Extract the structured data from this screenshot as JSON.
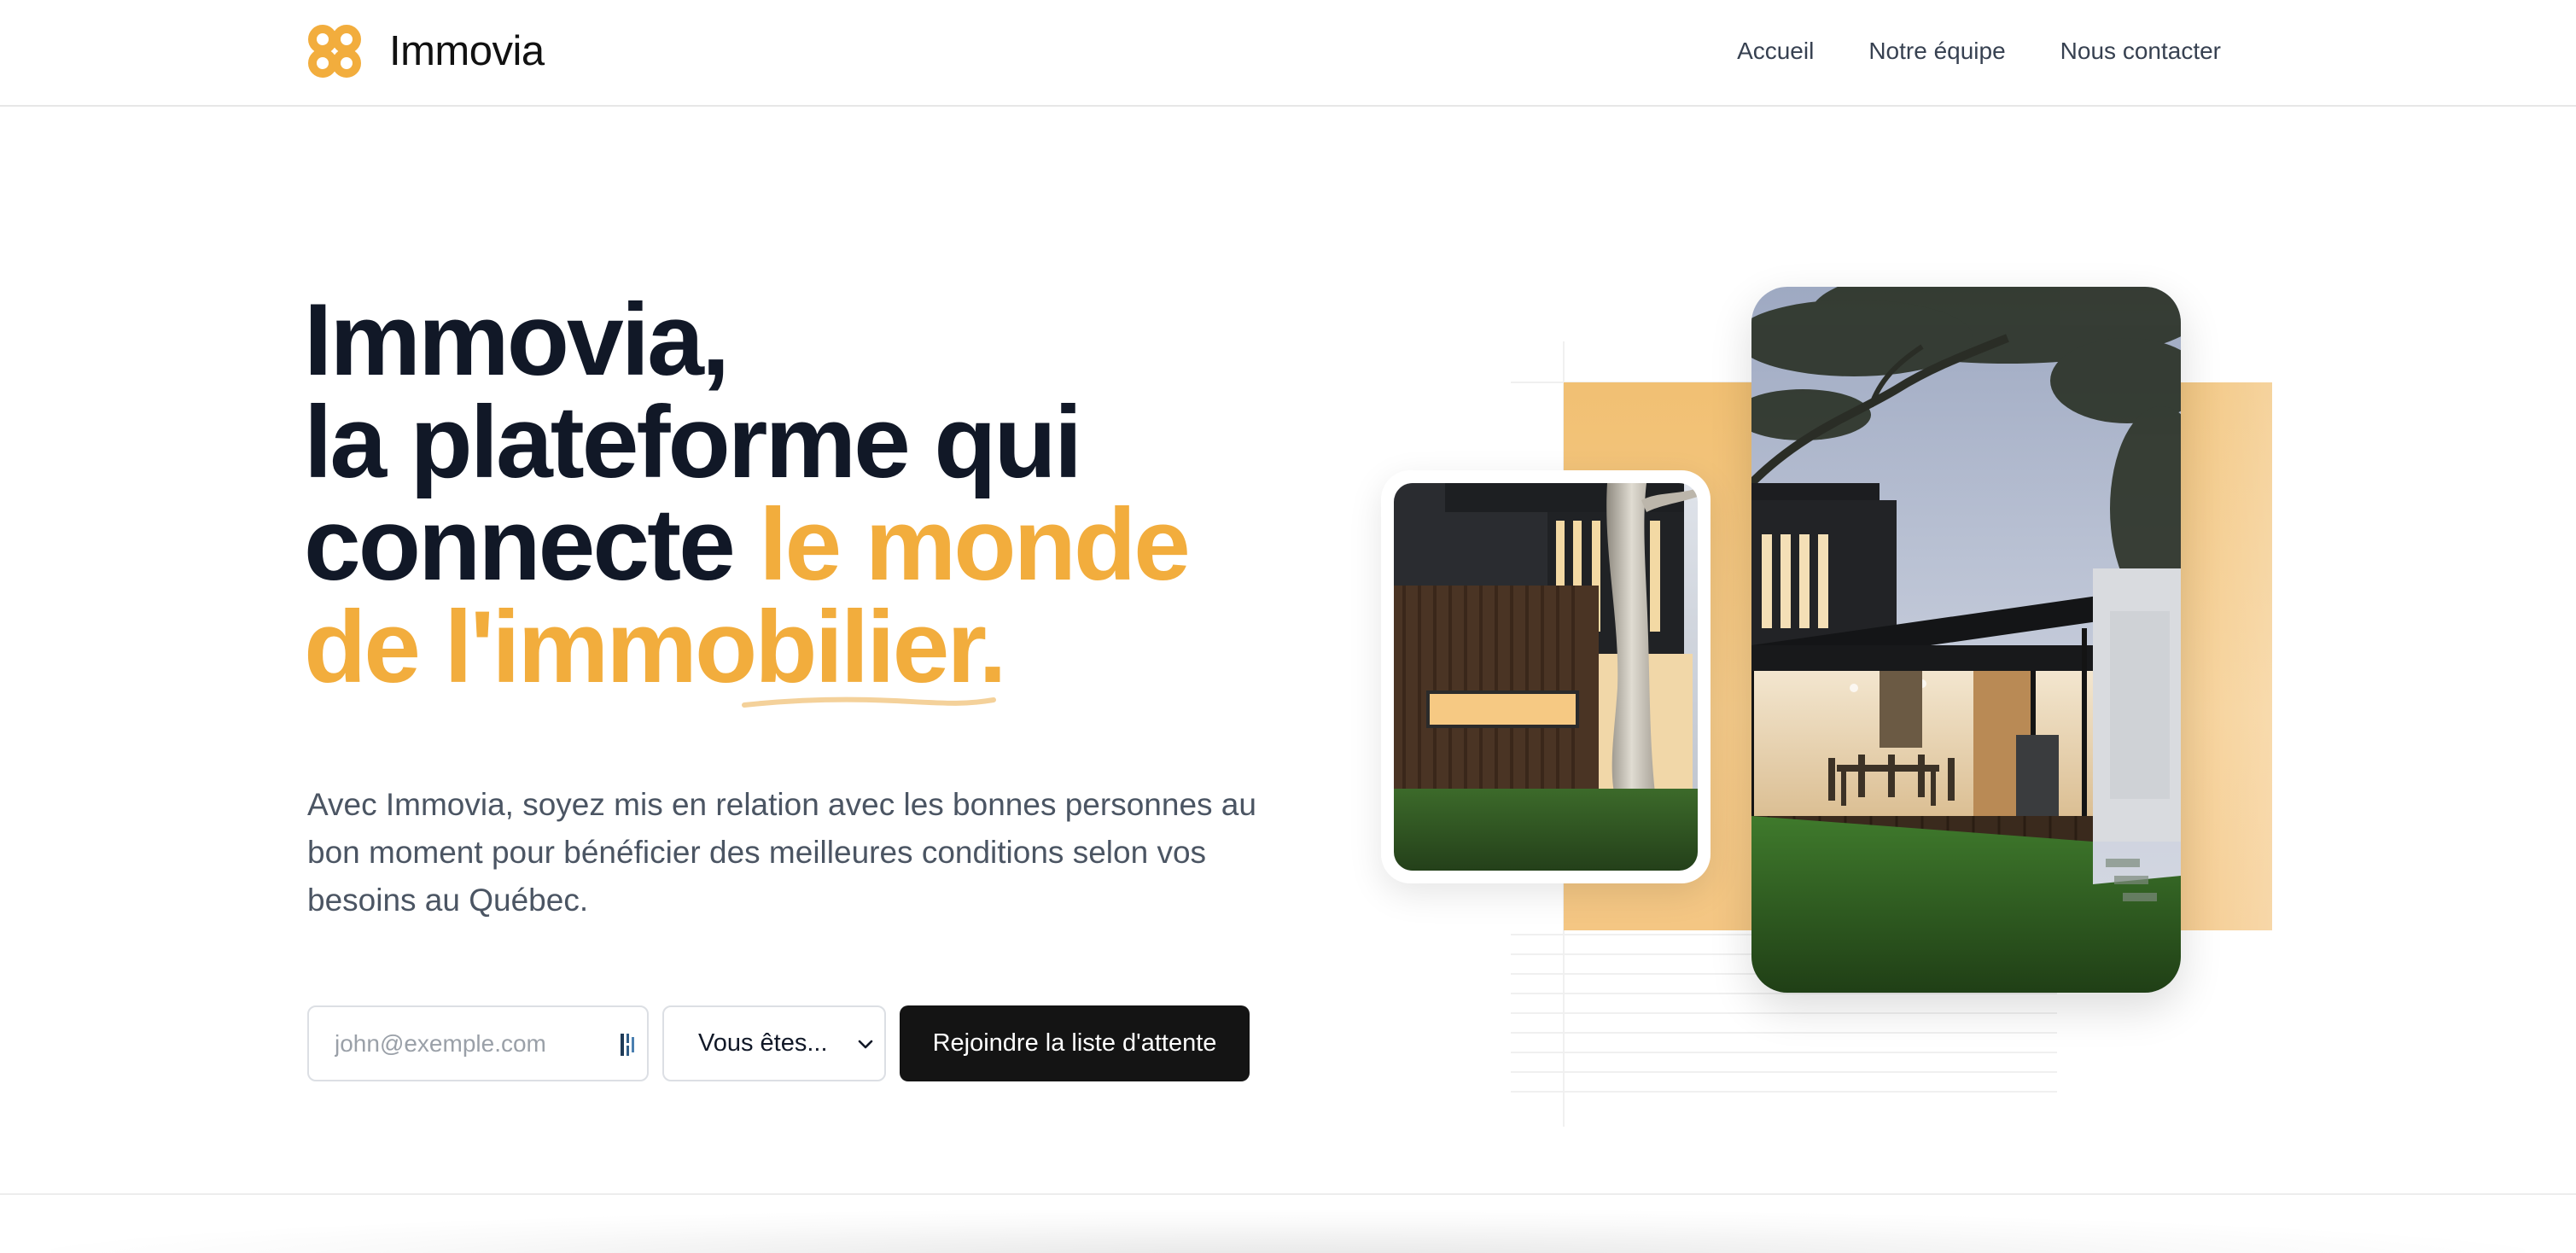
{
  "brand": {
    "name": "Immovia",
    "accent_color": "#f2ad3d",
    "logo_icon": "interlocked-rings-logo-icon"
  },
  "nav": {
    "items": [
      "Accueil",
      "Notre équipe",
      "Nous contacter"
    ]
  },
  "hero": {
    "title_line1": "Immovia,",
    "title_line2": "la plateforme qui",
    "title_line3_plain": "connecte ",
    "title_line3_accent": "le monde",
    "title_line4_accent": "de l'immobilier.",
    "subtitle": "Avec Immovia, soyez mis en relation avec les bonnes personnes au bon moment pour bénéficier des meilleures conditions selon vos besoins au Québec."
  },
  "form": {
    "email_placeholder": "john@exemple.com",
    "select_value": "Vous êtes...",
    "submit_label": "Rejoindre la liste d'attente"
  },
  "images": {
    "small": "modern-house-with-tree-photo",
    "large": "modern-house-patio-dusk-photo"
  }
}
